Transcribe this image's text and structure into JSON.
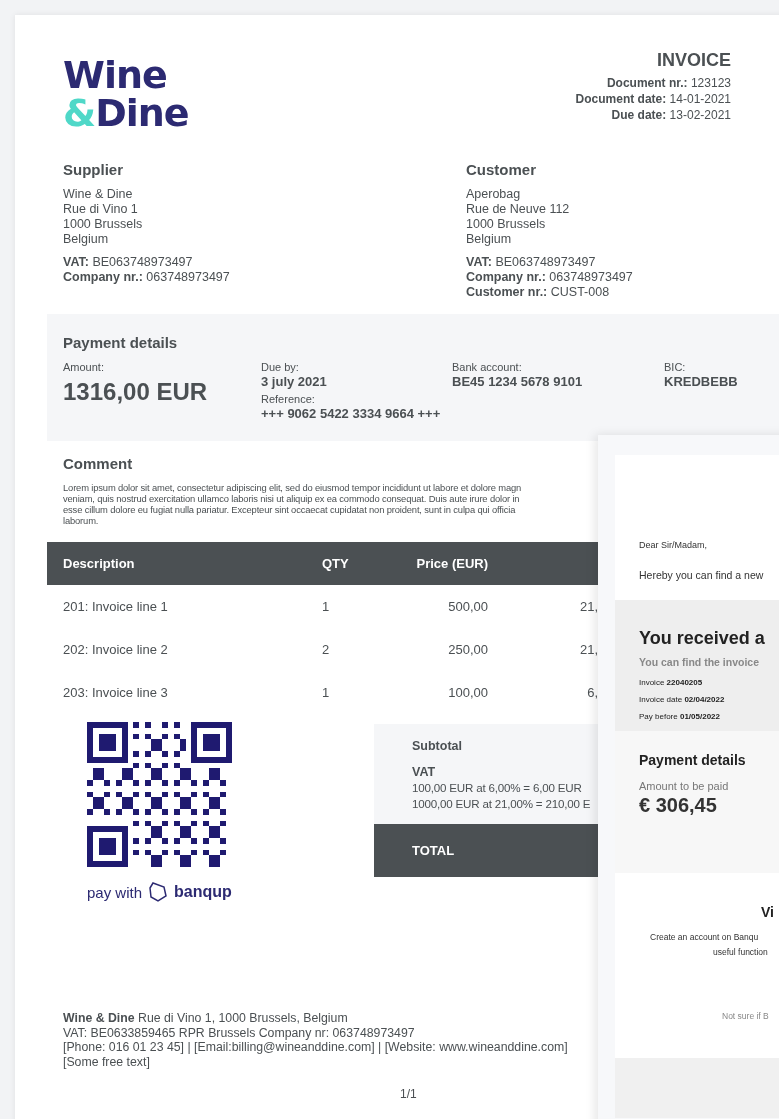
{
  "logo": {
    "line_1": "Wine",
    "ampersand": "&",
    "line_2": "Dine"
  },
  "header": {
    "title": "INVOICE",
    "meta": [
      "**Document nr.:** 123123",
      "**Document date:** 14-01-2021",
      "**Due date:** 13-02-2021"
    ]
  },
  "parties": [
    {
      "heading": "Supplier",
      "address": [
        "Wine & Dine",
        "Rue di Vino 1",
        "1000 Brussels",
        "Belgium"
      ],
      "ids": [
        "**VAT:** BE063748973497",
        "**Company nr.:** 063748973497"
      ]
    },
    {
      "heading": "Customer",
      "address": [
        "Aperobag",
        "Rue de Neuve 112",
        "1000 Brussels",
        "Belgium"
      ],
      "ids": [
        "**VAT:** BE063748973497",
        "**Company nr.:** 063748973497",
        "**Customer nr.:** CUST-008"
      ]
    }
  ],
  "payment": {
    "heading": "Payment details",
    "amount_label": "Amount:",
    "amount": "1316,00 EUR",
    "due_label": "Due by:",
    "due": "3 july 2021",
    "reference_label": "Reference:",
    "reference": "+++ 9062 5422 3334 9664 +++",
    "bank_label": "Bank account:",
    "bank": "BE45 1234 5678 9101",
    "bic_label": "BIC:",
    "bic": "KREDBEBB"
  },
  "comment": {
    "heading": "Comment",
    "lines": [
      "Lorem ipsum dolor sit amet, consectetur adipiscing elit, sed do eiusmod tempor incididunt ut labore et dolore magn",
      "veniam, quis nostrud exercitation ullamco laboris nisi ut aliquip ex ea commodo consequat. Duis aute irure dolor in",
      "esse cillum dolore eu fugiat nulla pariatur. Excepteur sint occaecat cupidatat non proident, sunt in culpa qui officia",
      "laborum."
    ]
  },
  "table": {
    "columns": [
      "Description",
      "QTY",
      "Price (EUR)"
    ],
    "rows": [
      [
        "201: Invoice line 1",
        "1",
        "500,00",
        "21,"
      ],
      [
        "202: Invoice line 2",
        "2",
        "250,00",
        "21,"
      ],
      [
        "203: Invoice line 3",
        "1",
        "100,00",
        "6,"
      ]
    ]
  },
  "qr": {
    "pay_with": "pay with",
    "brand": "banqup"
  },
  "totals": {
    "subtotal": "Subtotal",
    "vat": "VAT",
    "vat_lines": [
      "100,00 EUR at 6,00% = 6,00 EUR",
      "1000,00 EUR at 21,00% = 210,00 E"
    ],
    "total": "TOTAL"
  },
  "footer": {
    "lines": [
      "**Wine & Dine** Rue di Vino 1, 1000 Brussels, Belgium",
      "VAT: BE0633859465 RPR Brussels Company nr: 063748973497",
      "[Phone: 016 01 23 45] | [Email:billing@wineanddine.com] | [Website: www.wineanddine.com]",
      "[Some free text]"
    ],
    "page": "1/1"
  },
  "email": {
    "greeting": "Dear Sir/Madam,",
    "intro": "Hereby you can find a new",
    "banner_title": "You received a",
    "banner_sub": "You can find the invoice",
    "facts": [
      {
        "label": "Invoice",
        "value": "22040205"
      },
      {
        "label": "Invoice date",
        "value": "02/04/2022"
      },
      {
        "label": "Pay before",
        "value": "01/05/2022"
      }
    ],
    "payment_heading": "Payment details",
    "amount_label": "Amount to be paid",
    "amount": "€ 306,45",
    "cta_title": "Vi",
    "cta_lines": [
      "Create an account on Banqu",
      "useful function"
    ],
    "note": "Not sure if B"
  }
}
